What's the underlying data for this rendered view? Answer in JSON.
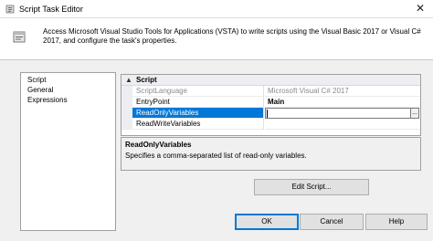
{
  "window": {
    "title": "Script Task Editor",
    "close_glyph": "✕"
  },
  "header": {
    "description": "Access Microsoft Visual Studio Tools for Applications (VSTA) to write scripts using the Visual Basic 2017 or Visual C# 2017, and configure the task's properties."
  },
  "nav": {
    "items": [
      {
        "label": "Script"
      },
      {
        "label": "General"
      },
      {
        "label": "Expressions"
      }
    ]
  },
  "grid": {
    "category": "Script",
    "category_toggle": "▲",
    "properties": [
      {
        "name": "ScriptLanguage",
        "value": "Microsoft Visual C# 2017"
      },
      {
        "name": "EntryPoint",
        "value": "Main"
      },
      {
        "name": "ReadOnlyVariables",
        "value": ""
      },
      {
        "name": "ReadWriteVariables",
        "value": ""
      }
    ],
    "ellipsis": "..."
  },
  "help": {
    "title": "ReadOnlyVariables",
    "text": "Specifies a comma-separated list of read-only variables."
  },
  "buttons": {
    "edit_script": "Edit Script...",
    "ok": "OK",
    "cancel": "Cancel",
    "help": "Help"
  },
  "colors": {
    "selection": "#0078d7",
    "default_button_border": "#0078d7"
  },
  "icons": {
    "app": "script-task-icon",
    "header": "script-task-icon",
    "close": "close-icon"
  }
}
